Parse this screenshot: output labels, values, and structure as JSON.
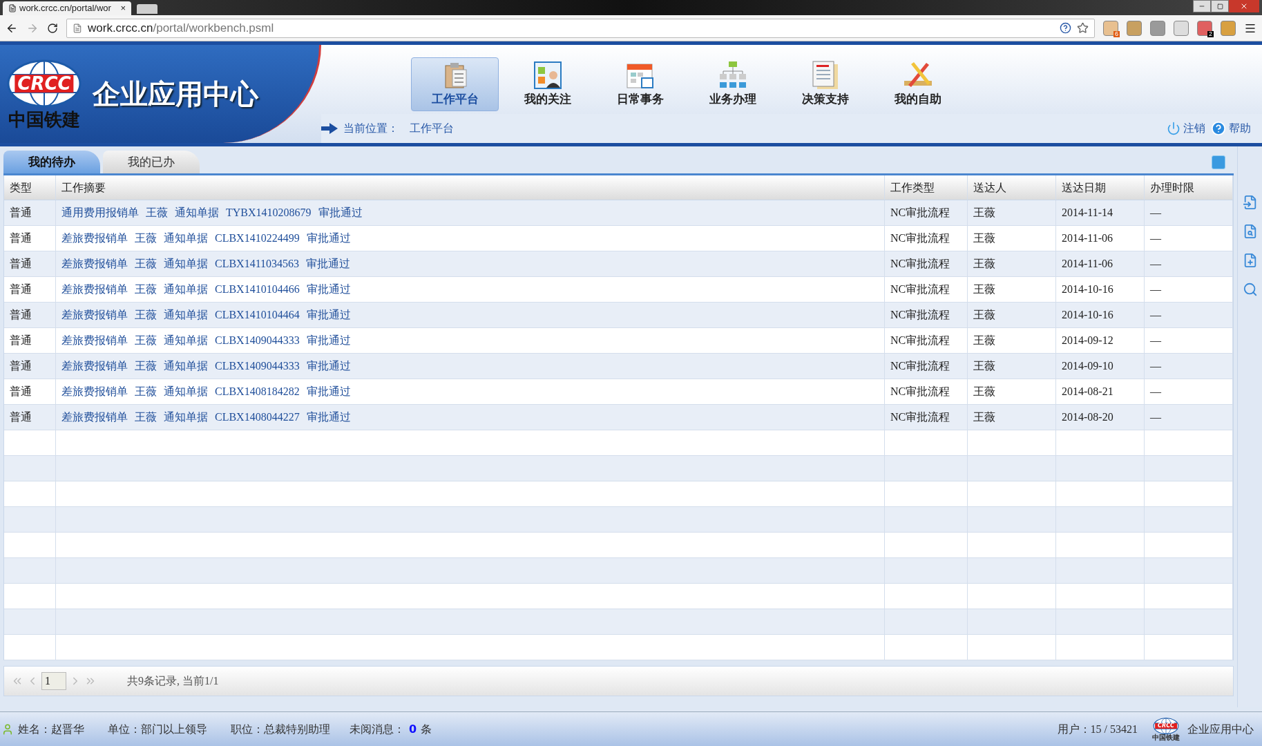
{
  "browser": {
    "tab_title": "work.crcc.cn/portal/wor",
    "tab_close": "×",
    "url_host": "work.crcc.cn",
    "url_path": "/portal/workbench.psml",
    "extension_badges": [
      {
        "kind": "java",
        "badge": "6"
      },
      {
        "kind": "lock"
      },
      {
        "kind": "page"
      },
      {
        "kind": "ip"
      },
      {
        "kind": "links",
        "badge": "2"
      },
      {
        "kind": "cookie"
      }
    ]
  },
  "header": {
    "logo": {
      "mark": "CRCC",
      "name": "中国铁建"
    },
    "title": "企业应用中心",
    "nav": [
      {
        "label": "工作平台",
        "kind": "clipboard",
        "selected": true
      },
      {
        "label": "我的关注",
        "kind": "person",
        "selected": false
      },
      {
        "label": "日常事务",
        "kind": "calendar",
        "selected": false
      },
      {
        "label": "业务办理",
        "kind": "org",
        "selected": false
      },
      {
        "label": "决策支持",
        "kind": "report",
        "selected": false
      },
      {
        "label": "我的自助",
        "kind": "tools",
        "selected": false
      }
    ],
    "breadcrumb": {
      "label": "当前位置：",
      "value": "工作平台"
    },
    "actions": [
      {
        "label": "注销",
        "kind": "power"
      },
      {
        "label": "帮助",
        "kind": "help"
      }
    ]
  },
  "tabs": [
    {
      "label": "我的待办",
      "selected": true
    },
    {
      "label": "我的已办",
      "selected": false
    }
  ],
  "table": {
    "columns": [
      "类型",
      "工作摘要",
      "工作类型",
      "送达人",
      "送达日期",
      "办理时限"
    ],
    "rows": [
      [
        "普通",
        "通用费用报销单 王薇 通知单据 TYBX1410208679 审批通过",
        "NC审批流程",
        "王薇",
        "2014-11-14",
        "—"
      ],
      [
        "普通",
        "差旅费报销单 王薇 通知单据 CLBX1410224499 审批通过",
        "NC审批流程",
        "王薇",
        "2014-11-06",
        "—"
      ],
      [
        "普通",
        "差旅费报销单 王薇 通知单据 CLBX1411034563 审批通过",
        "NC审批流程",
        "王薇",
        "2014-11-06",
        "—"
      ],
      [
        "普通",
        "差旅费报销单 王薇 通知单据 CLBX1410104466 审批通过",
        "NC审批流程",
        "王薇",
        "2014-10-16",
        "—"
      ],
      [
        "普通",
        "差旅费报销单 王薇 通知单据 CLBX1410104464 审批通过",
        "NC审批流程",
        "王薇",
        "2014-10-16",
        "—"
      ],
      [
        "普通",
        "差旅费报销单 王薇 通知单据 CLBX1409044333 审批通过",
        "NC审批流程",
        "王薇",
        "2014-09-12",
        "—"
      ],
      [
        "普通",
        "差旅费报销单 王薇 通知单据 CLBX1409044333 审批通过",
        "NC审批流程",
        "王薇",
        "2014-09-10",
        "—"
      ],
      [
        "普通",
        "差旅费报销单 王薇 通知单据 CLBX1408184282 审批通过",
        "NC审批流程",
        "王薇",
        "2014-08-21",
        "—"
      ],
      [
        "普通",
        "差旅费报销单 王薇 通知单据 CLBX1408044227 审批通过",
        "NC审批流程",
        "王薇",
        "2014-08-20",
        "—"
      ]
    ]
  },
  "pager": {
    "page": "1",
    "summary": "共9条记录, 当前1/1"
  },
  "status": {
    "fields": [
      {
        "label": "姓名：",
        "value": "赵晋华"
      },
      {
        "label": "单位：",
        "value": "部门以上领导"
      },
      {
        "label": "职位：",
        "value": "总裁特别助理"
      }
    ],
    "unread": {
      "label": "未阅消息：",
      "count": "0",
      "unit": "条"
    },
    "users": "用户：15 / 53421",
    "brand_mark": "CRCC",
    "brand_name": "中国铁建",
    "brand_title": "企业应用中心"
  }
}
